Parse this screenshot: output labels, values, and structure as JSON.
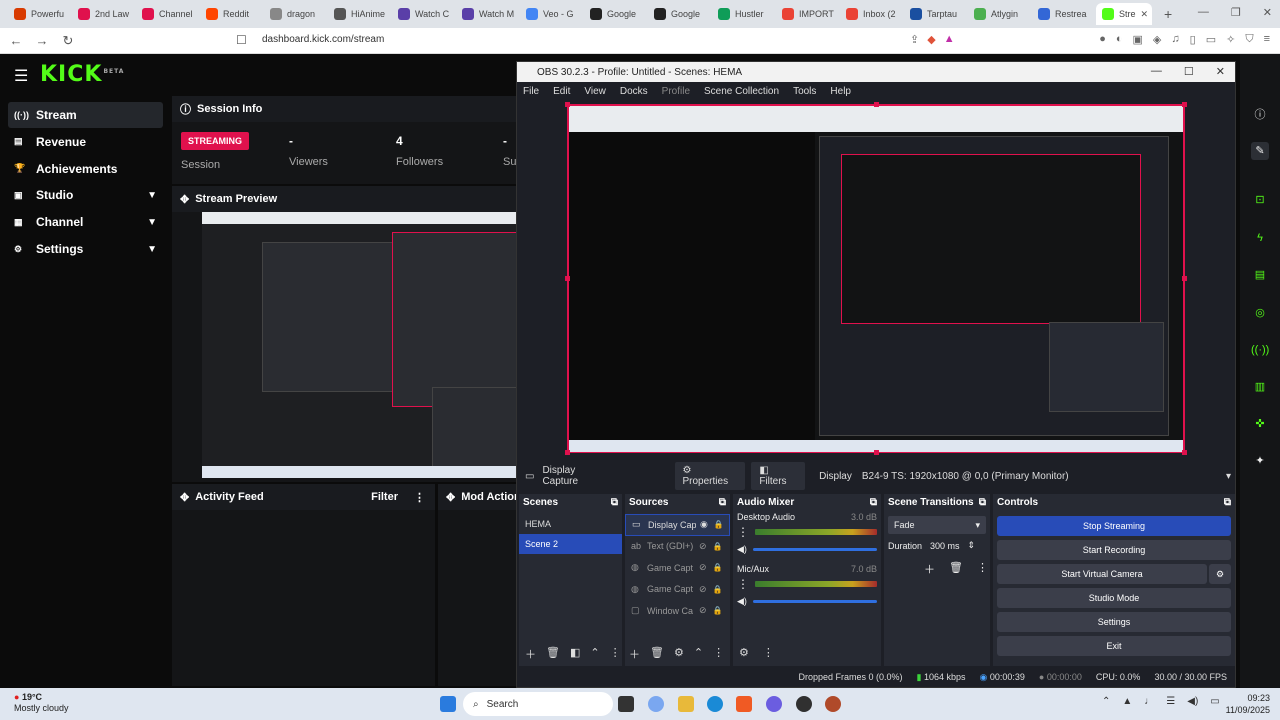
{
  "browser": {
    "tabs": [
      {
        "label": "Powerfu",
        "color": "#d83b01"
      },
      {
        "label": "2nd Law",
        "color": "#e0114d"
      },
      {
        "label": "Channel",
        "color": "#e0114d"
      },
      {
        "label": "Reddit",
        "color": "#ff4500"
      },
      {
        "label": "dragon",
        "color": "#888888"
      },
      {
        "label": "HiAnime",
        "color": "#555555"
      },
      {
        "label": "Watch C",
        "color": "#5a3fa8"
      },
      {
        "label": "Watch M",
        "color": "#5a3fa8"
      },
      {
        "label": "Veo - G",
        "color": "#4285f4"
      },
      {
        "label": "Google",
        "color": "#222222"
      },
      {
        "label": "Google",
        "color": "#222222"
      },
      {
        "label": "Hustler",
        "color": "#0f9d58"
      },
      {
        "label": "IMPORT",
        "color": "#ea4335"
      },
      {
        "label": "Inbox (2",
        "color": "#ea4335"
      },
      {
        "label": "Tarptau",
        "color": "#1a4fa0"
      },
      {
        "label": "Atlygin",
        "color": "#4caf50"
      },
      {
        "label": "Restrea",
        "color": "#3367d6"
      },
      {
        "label": "Stre",
        "color": "#53fc18"
      }
    ],
    "url": "dashboard.kick.com/stream"
  },
  "kick": {
    "logo": "KICK",
    "beta": "BETA",
    "sidebar": [
      {
        "label": "Stream",
        "icon": "broadcast-icon",
        "sel": true
      },
      {
        "label": "Revenue",
        "icon": "money-icon"
      },
      {
        "label": "Achievements",
        "icon": "trophy-icon"
      },
      {
        "label": "Studio",
        "icon": "studio-icon",
        "chev": "▼"
      },
      {
        "label": "Channel",
        "icon": "channel-icon",
        "chev": "▼"
      },
      {
        "label": "Settings",
        "icon": "gear-icon",
        "chev": "▼"
      }
    ],
    "session": {
      "title": "Session Info",
      "badge": "STREAMING",
      "session_label": "Session",
      "viewers_value": "-",
      "viewers_label": "Viewers",
      "followers_value": "4",
      "followers_label": "Followers",
      "subs_value": "-",
      "subs_label": "Sul"
    },
    "preview_title": "Stream Preview",
    "activity_title": "Activity Feed",
    "filter_label": "Filter",
    "mod_title": "Mod Actions"
  },
  "obs": {
    "title": "OBS 30.2.3 - Profile: Untitled - Scenes: HEMA",
    "menu": [
      "File",
      "Edit",
      "View",
      "Docks",
      "Profile",
      "Scene Collection",
      "Tools",
      "Help"
    ],
    "source_bar": {
      "name": "Display Capture",
      "properties": "Properties",
      "filters": "Filters",
      "display_label": "Display",
      "display_value": "B24-9 TS: 1920x1080 @ 0,0 (Primary Monitor)"
    },
    "scenes": {
      "title": "Scenes",
      "items": [
        "HEMA",
        "Scene 2"
      ]
    },
    "sources": {
      "title": "Sources",
      "items": [
        "Display Cap",
        "Text (GDI+)",
        "Game Capt",
        "Game Capt",
        "Window Ca"
      ]
    },
    "audio": {
      "title": "Audio Mixer",
      "channels": [
        {
          "name": "Desktop Audio",
          "db": "3.0 dB"
        },
        {
          "name": "Mic/Aux",
          "db": "7.0 dB"
        }
      ]
    },
    "transitions": {
      "title": "Scene Transitions",
      "type": "Fade",
      "duration_label": "Duration",
      "duration_value": "300 ms"
    },
    "controls": {
      "title": "Controls",
      "buttons": [
        "Stop Streaming",
        "Start Recording",
        "Start Virtual Camera",
        "Studio Mode",
        "Settings",
        "Exit"
      ]
    },
    "status": {
      "dropped": "Dropped Frames 0 (0.0%)",
      "kbps": "1064 kbps",
      "stream_time": "00:00:39",
      "rec_time": "00:00:00",
      "cpu": "CPU: 0.0%",
      "fps": "30.00 / 30.00 FPS"
    }
  },
  "taskbar": {
    "weather_temp": "19°C",
    "weather_desc": "Mostly cloudy",
    "search": "Search",
    "time": "09:23",
    "date": "11/09/2025"
  }
}
